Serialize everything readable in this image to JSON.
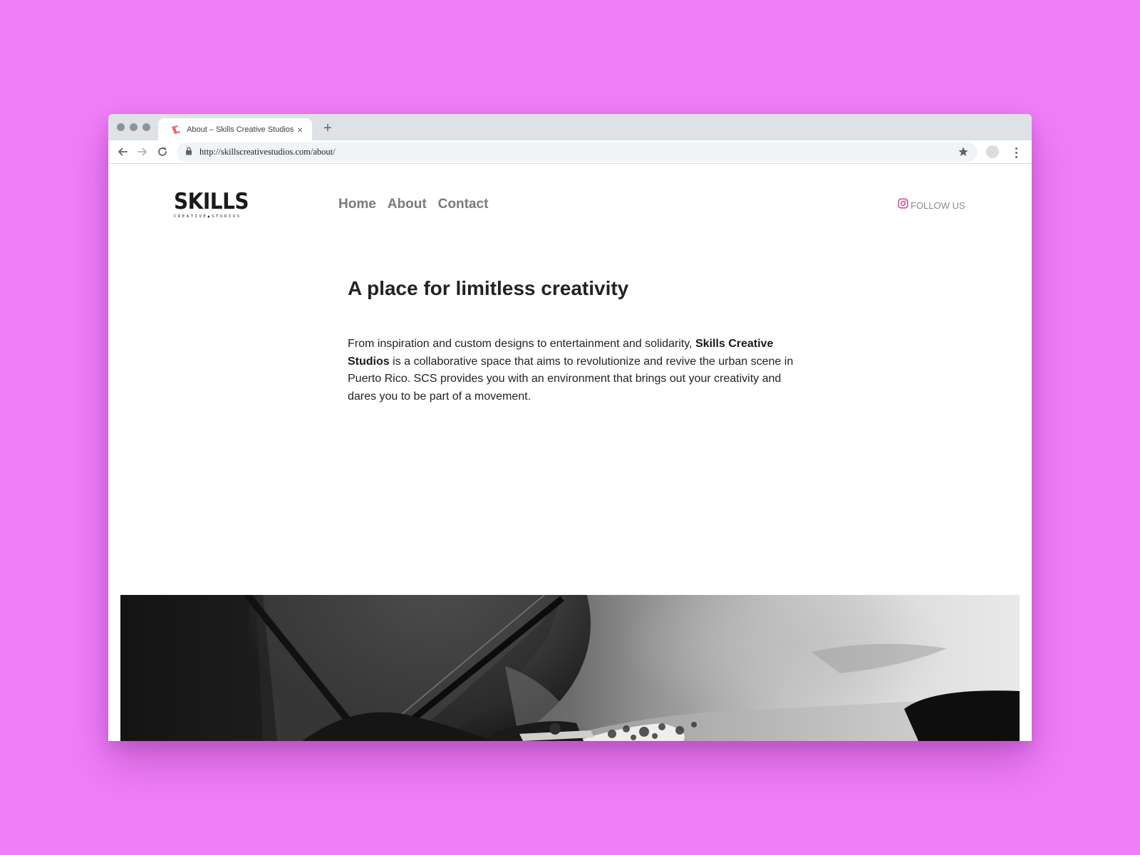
{
  "browser": {
    "tab_title": "About – Skills Creative Studios",
    "tab_close": "×",
    "new_tab": "+",
    "url": "http://skillscreativestudios.com/about/"
  },
  "site": {
    "logo_main": "SKILLS",
    "logo_sub": "CREATIVE▲STUDIOS",
    "nav": [
      "Home",
      "About",
      "Contact"
    ],
    "follow_label": "FOLLOW US",
    "accent_color": "#e0509e",
    "headline": "A place for limitless creativity",
    "intro": {
      "part1": "From inspiration and custom designs to entertainment and solidarity, ",
      "bold": "Skills Creative Studios",
      "part2": " is a collaborative space that aims to revolutionize and revive the urban scene in Puerto Rico. SCS provides you with an environment that brings out your creativity and dares you to be part of a movement."
    }
  }
}
